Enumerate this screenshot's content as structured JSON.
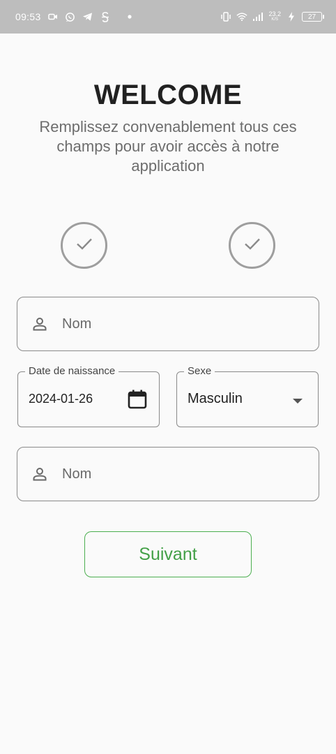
{
  "status_bar": {
    "time": "09:53",
    "network_speed": "23.2",
    "network_speed_unit": "K/S",
    "battery": "27",
    "left_icons": [
      "video-icon",
      "whatsapp-icon",
      "telegram-icon",
      "app-icon",
      "dot-icon"
    ],
    "right_icons": [
      "vibrate-icon",
      "wifi-icon",
      "signal-icon",
      "charging-icon",
      "battery-icon"
    ]
  },
  "header": {
    "title": "WELCOME",
    "subtitle": "Remplissez convenablement tous ces champs pour avoir accès à notre application"
  },
  "steps": [
    {
      "icon": "check-icon",
      "state": "completed"
    },
    {
      "icon": "check-icon",
      "state": "completed"
    }
  ],
  "form": {
    "nom_1": {
      "placeholder": "Nom",
      "icon": "person-icon"
    },
    "birth_date": {
      "label": "Date de naissance",
      "value": "2024-01-26",
      "icon": "calendar-icon"
    },
    "sexe": {
      "label": "Sexe",
      "value": "Masculin",
      "icon": "dropdown-arrow-icon"
    },
    "nom_2": {
      "placeholder": "Nom",
      "icon": "person-icon"
    },
    "next_label": "Suivant"
  },
  "colors": {
    "accent": "#43a047",
    "status_bar": "#bdbdbd",
    "background": "#fafafa",
    "border": "#8a8a8a"
  }
}
